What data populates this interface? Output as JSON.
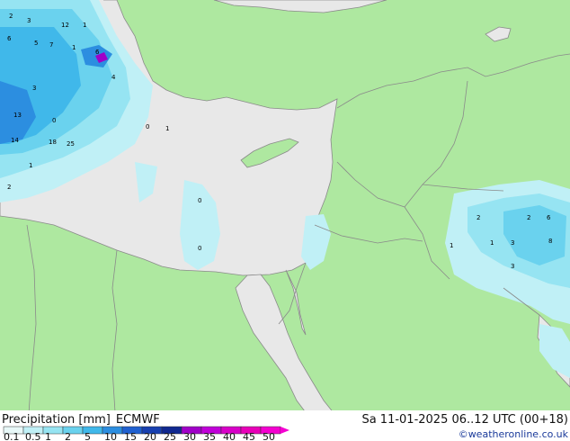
{
  "title": "Precipitation [mm]",
  "model": "ECMWF",
  "valid_time": "Sa 11-01-2025 06..12 UTC (00+18)",
  "credit": "©weatheronline.co.uk",
  "legend": {
    "values": [
      "0.1",
      "0.5",
      "1",
      "2",
      "5",
      "10",
      "15",
      "20",
      "25",
      "30",
      "35",
      "40",
      "45",
      "50"
    ],
    "colors": [
      "#e8f8f8",
      "#c0f0f6",
      "#96e4f2",
      "#6ad2ee",
      "#40b8ea",
      "#2c8ee0",
      "#2060d0",
      "#1840b0",
      "#102890",
      "#a000c8",
      "#c000d8",
      "#d800c8",
      "#e800b8",
      "#f400d0"
    ]
  },
  "colors": {
    "land": "#aee8a0",
    "sea": "#e8e8e8",
    "border": "#8a8a8a"
  },
  "point_values": [
    "2",
    "3",
    "6",
    "12",
    "1",
    "5",
    "7",
    "1",
    "13",
    "14",
    "18",
    "25",
    "0",
    "2",
    "1",
    "3",
    "4",
    "6",
    "0",
    "1",
    "3",
    "2",
    "1",
    "8",
    "6",
    "0",
    "1",
    "2",
    "0",
    "3"
  ]
}
